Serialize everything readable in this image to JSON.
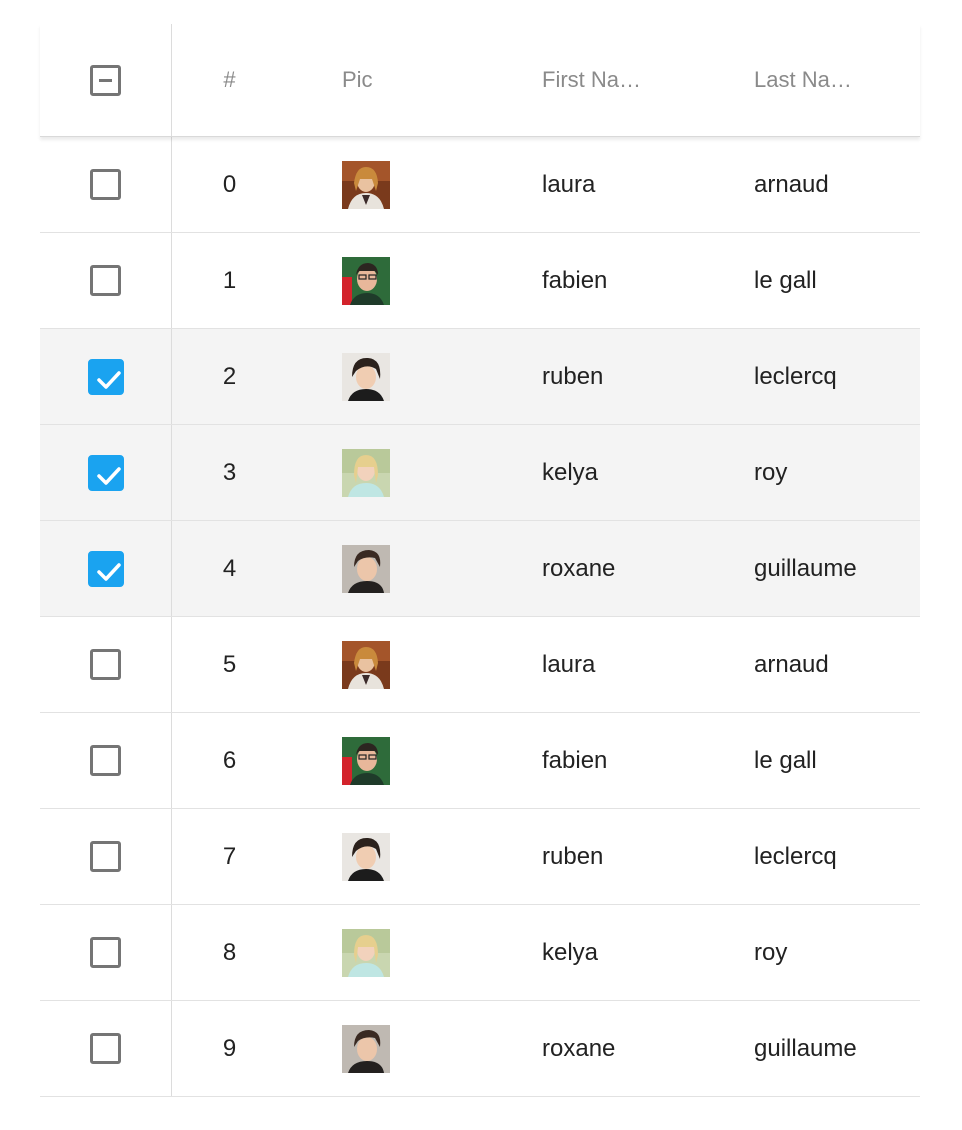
{
  "header": {
    "num_label": "#",
    "pic_label": "Pic",
    "first_name_label": "First Na…",
    "last_name_label": "Last Na…",
    "select_all_state": "indeterminate"
  },
  "rows": [
    {
      "index": "0",
      "first": "laura",
      "last": "arnaud",
      "selected": false,
      "avatar": "avatar-laura"
    },
    {
      "index": "1",
      "first": "fabien",
      "last": "le gall",
      "selected": false,
      "avatar": "avatar-fabien"
    },
    {
      "index": "2",
      "first": "ruben",
      "last": "leclercq",
      "selected": true,
      "avatar": "avatar-ruben"
    },
    {
      "index": "3",
      "first": "kelya",
      "last": "roy",
      "selected": true,
      "avatar": "avatar-kelya"
    },
    {
      "index": "4",
      "first": "roxane",
      "last": "guillaume",
      "selected": true,
      "avatar": "avatar-roxane"
    },
    {
      "index": "5",
      "first": "laura",
      "last": "arnaud",
      "selected": false,
      "avatar": "avatar-laura"
    },
    {
      "index": "6",
      "first": "fabien",
      "last": "le gall",
      "selected": false,
      "avatar": "avatar-fabien"
    },
    {
      "index": "7",
      "first": "ruben",
      "last": "leclercq",
      "selected": false,
      "avatar": "avatar-ruben"
    },
    {
      "index": "8",
      "first": "kelya",
      "last": "roy",
      "selected": false,
      "avatar": "avatar-kelya"
    },
    {
      "index": "9",
      "first": "roxane",
      "last": "guillaume",
      "selected": false,
      "avatar": "avatar-roxane"
    }
  ],
  "colors": {
    "checkbox_accent": "#1aa3f0",
    "selected_row_bg": "#f4f4f4",
    "header_text": "#8a8a8a"
  }
}
